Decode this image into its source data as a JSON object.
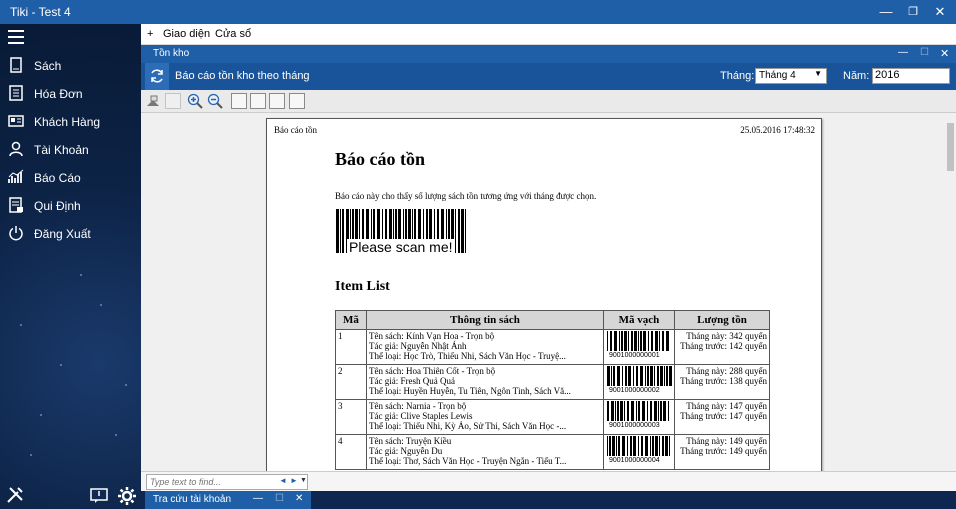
{
  "window": {
    "title": "Tiki - Test 4",
    "minimize": "—",
    "restore": "❐",
    "close": "✕"
  },
  "sidebar": {
    "items": [
      {
        "label": "Sách",
        "icon": "book-icon"
      },
      {
        "label": "Hóa Đơn",
        "icon": "invoice-icon"
      },
      {
        "label": "Khách Hàng",
        "icon": "id-card-icon"
      },
      {
        "label": "Tài Khoản",
        "icon": "user-icon"
      },
      {
        "label": "Báo Cáo",
        "icon": "chart-icon"
      },
      {
        "label": "Qui Định",
        "icon": "rules-icon"
      },
      {
        "label": "Đăng Xuất",
        "icon": "power-icon"
      }
    ]
  },
  "menu": {
    "plus": "+",
    "items": [
      "Giao diện",
      "Cửa sổ"
    ]
  },
  "doc_window": {
    "title": "Tồn kho",
    "minimize": "—",
    "restore": "☐",
    "close": "✕"
  },
  "ribbon": {
    "title": "Báo cáo tồn kho theo tháng",
    "month_label": "Tháng:",
    "month_value": "Tháng 4",
    "year_label": "Năm:",
    "year_value": "2016"
  },
  "report": {
    "header_left": "Báo cáo tồn",
    "header_right": "25.05.2016 17:48:32",
    "title": "Báo cáo tồn",
    "description": "Báo cáo này cho thấy số lượng sách tồn tương ứng với tháng được chọn.",
    "barcode_text": "Please scan me!",
    "list_title": "Item List",
    "columns": [
      "Mã",
      "Thông tin sách",
      "Mã vạch",
      "Lượng tồn"
    ],
    "rows": [
      {
        "ma": "1",
        "ten": "Tên sách: Kính Vạn Hoa - Trọn bộ",
        "tacgia": "Tác giả: Nguyễn Nhật Ánh",
        "theloai": "Thể loại: Học Trò, Thiếu Nhi, Sách Văn Học - Truyệ...",
        "barcode": "9001000000001",
        "thangnay": "Tháng này: 342 quyển",
        "thangtruoc": "Tháng trước: 142 quyển"
      },
      {
        "ma": "2",
        "ten": "Tên sách: Hoa Thiên Cốt - Trọn bộ",
        "tacgia": "Tác giả: Fresh Quả Quả",
        "theloai": "Thể loại: Huyền Huyễn, Tu Tiên, Ngôn Tình, Sách Vă...",
        "barcode": "9001000000002",
        "thangnay": "Tháng này: 288 quyển",
        "thangtruoc": "Tháng trước: 138 quyển"
      },
      {
        "ma": "3",
        "ten": "Tên sách: Narnia - Trọn bộ",
        "tacgia": "Tác giả: Clive Staples Lewis",
        "theloai": "Thể loại: Thiếu Nhi, Kỳ Ảo, Sử Thi, Sách Văn Học -...",
        "barcode": "9001000000003",
        "thangnay": "Tháng này: 147 quyển",
        "thangtruoc": "Tháng trước: 147 quyển"
      },
      {
        "ma": "4",
        "ten": "Tên sách: Truyện Kiều",
        "tacgia": "Tác giả: Nguyễn Du",
        "theloai": "Thể loại: Thơ, Sách Văn Học - Truyện Ngắn - Tiểu T...",
        "barcode": "9001000000004",
        "thangnay": "Tháng này: 149 quyển",
        "thangtruoc": "Tháng trước: 149 quyển"
      }
    ]
  },
  "find": {
    "placeholder": "Type text to find...",
    "prev": "◄",
    "next": "►",
    "dropdown": "▼"
  },
  "bottom_tab": {
    "title": "Tra cứu tài khoản",
    "minimize": "—",
    "restore": "☐",
    "close": "✕"
  }
}
